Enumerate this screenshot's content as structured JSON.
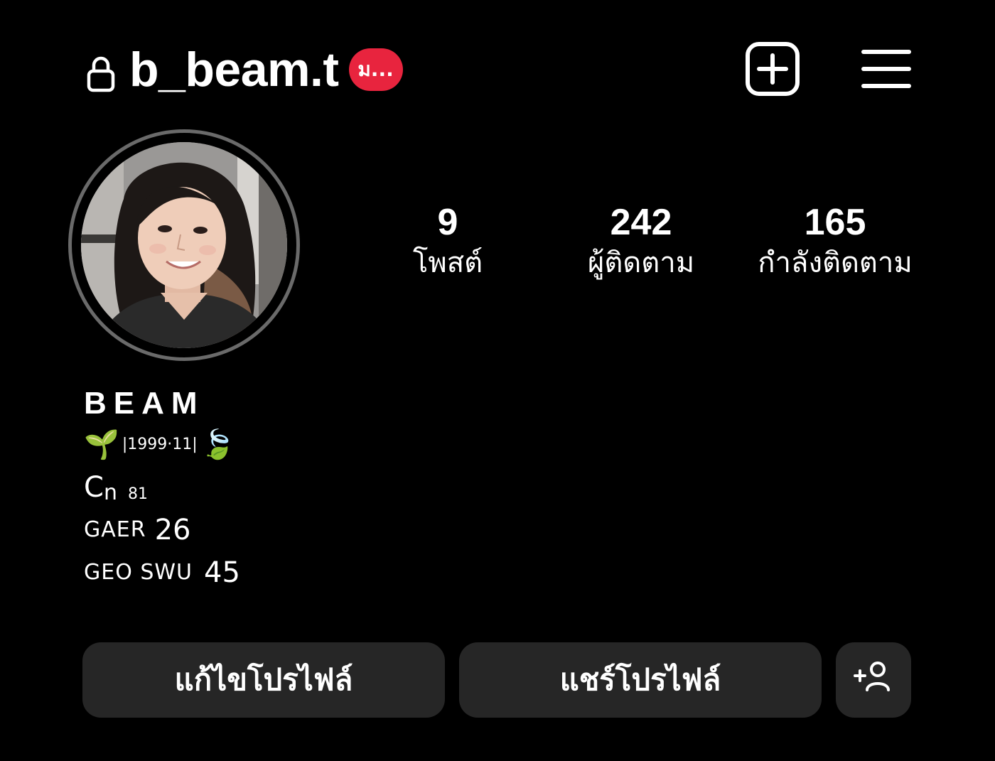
{
  "header": {
    "username": "b_beam.t",
    "notes_badge": "ม...",
    "icons": [
      "lock-icon",
      "create-post-icon",
      "menu-icon"
    ]
  },
  "profile": {
    "avatar_alt": "profile-photo"
  },
  "stats": [
    {
      "count": "9",
      "label": "โพสต์"
    },
    {
      "count": "242",
      "label": "ผู้ติดตาม"
    },
    {
      "count": "165",
      "label": "กำลังติดตาม"
    }
  ],
  "bio": {
    "name": "BEAM",
    "line1_emoji_left": "🌱",
    "line1_text": "|1999·11|",
    "line1_emoji_right": "🍃",
    "line2_main": "C",
    "line2_sub": "n",
    "line2_num": "81",
    "line3_small": "GAER",
    "line3_num": "26",
    "line4_small": "GEO SWU",
    "line4_num": "45"
  },
  "buttons": {
    "edit_profile": "แก้ไขโปรไฟล์",
    "share_profile": "แชร์โปรไฟล์"
  },
  "colors": {
    "background": "#000000",
    "badge": "#e8243e",
    "button_bg": "#262626",
    "avatar_ring": "#6a6a6a"
  }
}
